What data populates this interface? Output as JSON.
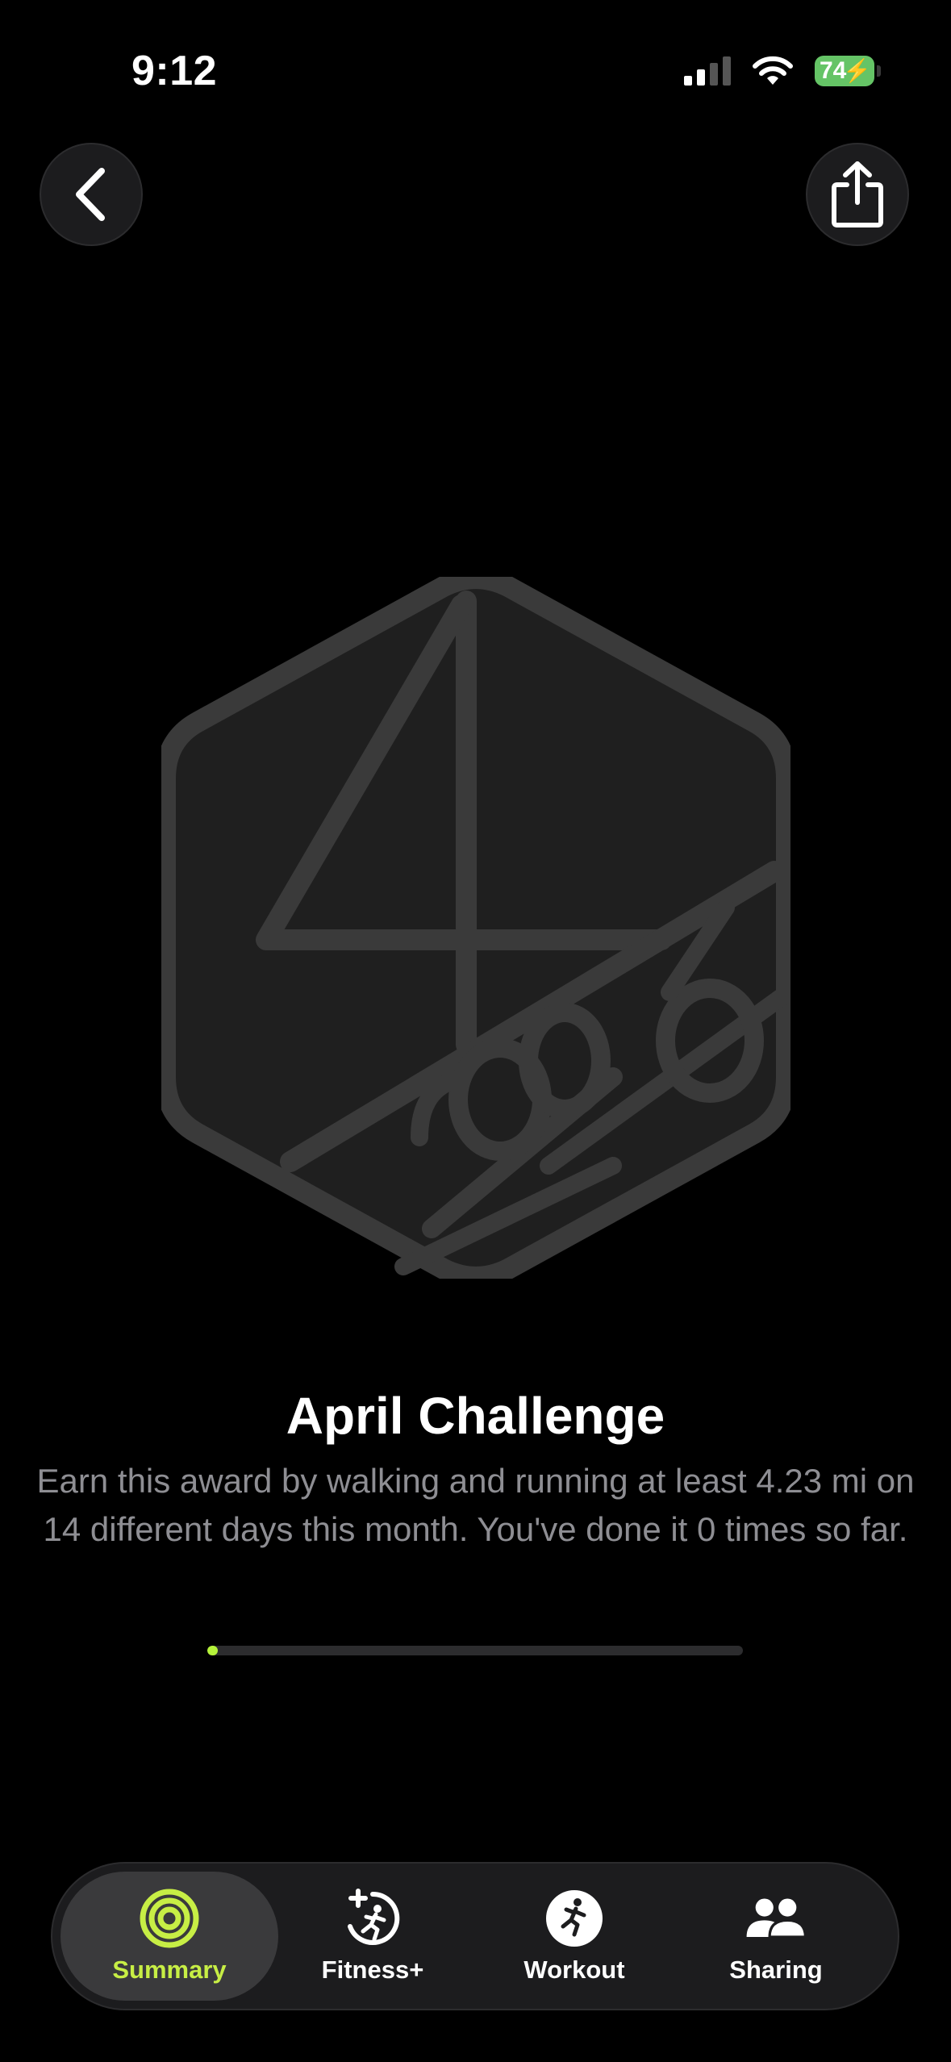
{
  "status": {
    "time": "9:12",
    "battery": "74"
  },
  "header": {
    "back_icon": "chevron-left-icon",
    "share_icon": "share-icon"
  },
  "award": {
    "title": "April Challenge",
    "description": "Earn this award by walking and running at least 4.23 mi on 14 different days this month. You've done it 0 times so far.",
    "progress_fraction": 0.02
  },
  "tabs": [
    {
      "label": "Summary",
      "icon": "activity-rings-icon",
      "active": true
    },
    {
      "label": "Fitness+",
      "icon": "fitness-plus-icon",
      "active": false
    },
    {
      "label": "Workout",
      "icon": "running-figure-icon",
      "active": false
    },
    {
      "label": "Sharing",
      "icon": "people-icon",
      "active": false
    }
  ],
  "colors": {
    "accent": "#c7ee45",
    "progress": "#b5f23a",
    "battery": "#65c466",
    "badge_stroke": "#3a3a3a",
    "badge_fill": "#1f1f1f"
  }
}
